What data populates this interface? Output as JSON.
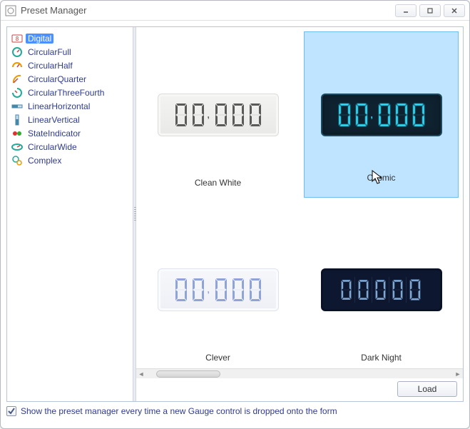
{
  "window": {
    "title": "Preset Manager"
  },
  "sidebar": {
    "items": [
      {
        "label": "Digital",
        "icon": "digital",
        "selected": true
      },
      {
        "label": "CircularFull",
        "icon": "circ-full"
      },
      {
        "label": "CircularHalf",
        "icon": "circ-half"
      },
      {
        "label": "CircularQuarter",
        "icon": "circ-quarter"
      },
      {
        "label": "CircularThreeFourth",
        "icon": "circ-threequarter"
      },
      {
        "label": "LinearHorizontal",
        "icon": "linear-h"
      },
      {
        "label": "LinearVertical",
        "icon": "linear-v"
      },
      {
        "label": "StateIndicator",
        "icon": "state"
      },
      {
        "label": "CircularWide",
        "icon": "circ-wide"
      },
      {
        "label": "Complex",
        "icon": "complex"
      }
    ]
  },
  "previews": {
    "items": [
      {
        "name": "Clean White",
        "style": "light",
        "digits": "00,000",
        "color": "#5a5a58",
        "selected": false
      },
      {
        "name": "Cosmic",
        "style": "cosmic",
        "digits": "00,000",
        "color": "#2fe1ff",
        "selected": true
      },
      {
        "name": "Clever",
        "style": "clever",
        "digits": "00,000",
        "color": "#8ea3d8",
        "selected": false
      },
      {
        "name": "Dark Night",
        "style": "darknight",
        "digits": "00000",
        "color": "#7ea7d4",
        "selected": false
      }
    ]
  },
  "buttons": {
    "load": "Load"
  },
  "footer": {
    "checkbox_checked": true,
    "label": "Show the preset manager every time a new Gauge control is dropped onto the form"
  }
}
